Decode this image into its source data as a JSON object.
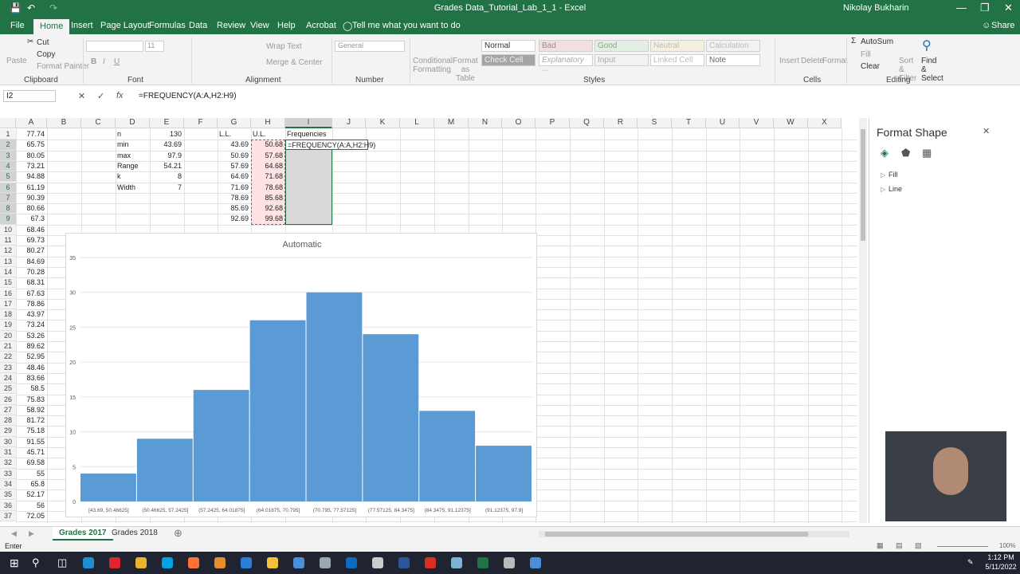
{
  "titlebar": {
    "title": "Grades Data_Tutorial_Lab_1_1  -  Excel",
    "user": "Nikolay Bukharin",
    "share": "Share"
  },
  "tabs": [
    "File",
    "Home",
    "Insert",
    "Page Layout",
    "Formulas",
    "Data",
    "Review",
    "View",
    "Help",
    "Acrobat"
  ],
  "tell_me": "Tell me what you want to do",
  "ribbon": {
    "clipboard": {
      "paste": "Paste",
      "cut": "Cut",
      "copy": "Copy",
      "format_painter": "Format Painter",
      "label": "Clipboard"
    },
    "font": {
      "label": "Font",
      "size": "11",
      "bold": "B",
      "italic": "I",
      "underline": "U"
    },
    "alignment": {
      "wrap": "Wrap Text",
      "merge": "Merge & Center",
      "label": "Alignment"
    },
    "number": {
      "format": "General",
      "label": "Number"
    },
    "styles": {
      "conditional": "Conditional Formatting",
      "format_as_table": "Format as Table",
      "normal": "Normal",
      "bad": "Bad",
      "good": "Good",
      "neutral": "Neutral",
      "calculation": "Calculation",
      "check_cell": "Check Cell",
      "explanatory": "Explanatory ...",
      "input": "Input",
      "linked_cell": "Linked Cell",
      "note": "Note",
      "label": "Styles"
    },
    "cells": {
      "insert": "Insert",
      "delete": "Delete",
      "format": "Format",
      "label": "Cells"
    },
    "editing": {
      "autosum": "AutoSum",
      "fill": "Fill",
      "clear": "Clear",
      "sort": "Sort & Filter",
      "find": "Find & Select",
      "label": "Editing"
    }
  },
  "formula_bar": {
    "name_box": "I2",
    "formula": "=FREQUENCY(A:A,H2:H9)"
  },
  "columns": [
    "A",
    "B",
    "C",
    "D",
    "E",
    "F",
    "G",
    "H",
    "I",
    "J",
    "K",
    "L",
    "M",
    "N",
    "O",
    "P",
    "Q",
    "R",
    "S",
    "T",
    "U",
    "V",
    "W",
    "X"
  ],
  "rows": [
    "1",
    "2",
    "3",
    "4",
    "5",
    "6",
    "7",
    "8",
    "9",
    "10",
    "11",
    "12",
    "13",
    "14",
    "15",
    "16",
    "17",
    "18",
    "19",
    "20",
    "21",
    "22",
    "23",
    "24",
    "25",
    "26",
    "27",
    "28",
    "29",
    "30",
    "31",
    "32",
    "33",
    "34",
    "35",
    "36",
    "37"
  ],
  "col_a": [
    "77.74",
    "65.75",
    "80.05",
    "73.21",
    "94.88",
    "61.19",
    "90.39",
    "80.66",
    "67.3",
    "68.46",
    "69.73",
    "80.27",
    "84.69",
    "70.28",
    "68.31",
    "67.63",
    "78.86",
    "43.97",
    "73.24",
    "53.26",
    "89.62",
    "52.95",
    "48.46",
    "83.66",
    "58.5",
    "75.83",
    "58.92",
    "81.72",
    "75.18",
    "91.55",
    "45.71",
    "69.58",
    "55",
    "65.8",
    "52.17",
    "56",
    "72.05"
  ],
  "stats": {
    "labels": [
      "n",
      "min",
      "max",
      "Range",
      "k",
      "Width"
    ],
    "values": [
      "130",
      "43.69",
      "97.9",
      "54.21",
      "8",
      "7"
    ]
  },
  "bins": {
    "ll_header": "L.L.",
    "ul_header": "U.L.",
    "freq_header": "Frequencies",
    "ll": [
      "43.69",
      "50.69",
      "57.69",
      "64.69",
      "71.69",
      "78.69",
      "85.69",
      "92.69"
    ],
    "ul": [
      "50.68",
      "57.68",
      "64.68",
      "71.68",
      "78.68",
      "85.68",
      "92.68",
      "99.68"
    ],
    "editing_cell": "=FREQUENCY(A:A,H2:H9)"
  },
  "chart_data": {
    "type": "bar",
    "title": "Automatic",
    "categories": [
      "[43.69, 50.46625]",
      "(50.46625, 57.2425]",
      "(57.2425, 64.01875]",
      "(64.01875, 70.795]",
      "(70.795, 77.57125]",
      "(77.57125, 84.3475]",
      "(84.3475, 91.12375]",
      "(91.12375, 97.9]"
    ],
    "values": [
      4,
      9,
      16,
      26,
      30,
      24,
      13,
      8
    ],
    "ylim": [
      0,
      35
    ],
    "yticks": [
      "0",
      "5",
      "10",
      "15",
      "20",
      "25",
      "30",
      "35"
    ],
    "grid": true,
    "color": "#5b9bd5"
  },
  "pane": {
    "title": "Format Shape",
    "fill": "Fill",
    "line": "Line"
  },
  "sheets": [
    "Grades 2017",
    "Grades 2018"
  ],
  "status": {
    "mode": "Enter",
    "zoom": "100%"
  },
  "clock": {
    "time": "1:12 PM",
    "date": "5/11/2022"
  }
}
